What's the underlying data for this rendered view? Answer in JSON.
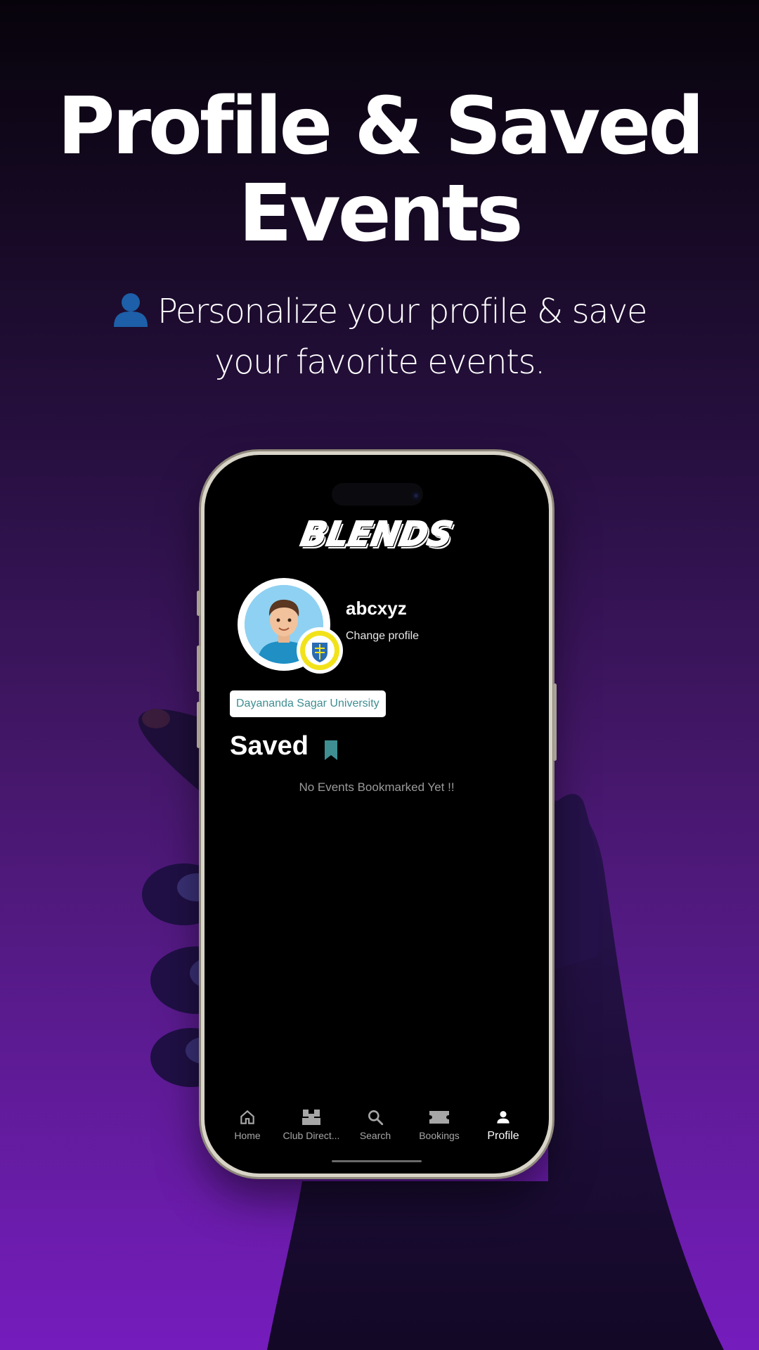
{
  "headline": {
    "line1": "Profile & Saved",
    "line2": "Events"
  },
  "subtitle": {
    "icon": "person-icon",
    "line1": "Personalize your profile & save",
    "line2": "your favorite events."
  },
  "app": {
    "logo_text": "BLENDS"
  },
  "profile": {
    "username": "abcxyz",
    "change_label": "Change profile",
    "university": "Dayananda Sagar University"
  },
  "saved": {
    "title": "Saved",
    "empty_message": "No Events Bookmarked Yet !!"
  },
  "bottom_nav": {
    "items": [
      {
        "label": "Home",
        "icon": "home-icon"
      },
      {
        "label": "Club Direct...",
        "icon": "club-directory-icon"
      },
      {
        "label": "Search",
        "icon": "search-icon"
      },
      {
        "label": "Bookings",
        "icon": "ticket-icon"
      },
      {
        "label": "Profile",
        "icon": "profile-icon"
      }
    ],
    "active": "Profile"
  },
  "colors": {
    "accent_teal": "#3f8e92",
    "background_top": "#07030b",
    "background_bottom": "#751cbd"
  }
}
